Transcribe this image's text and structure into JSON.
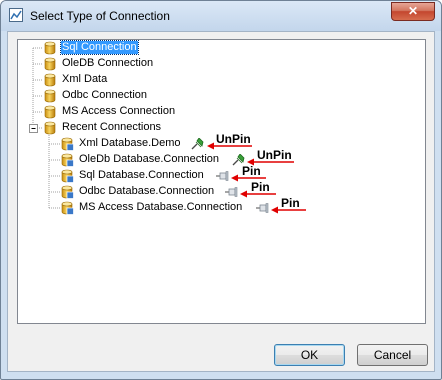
{
  "window": {
    "title": "Select Type of Connection",
    "close_glyph": "✕"
  },
  "tree": {
    "items": [
      {
        "label": "Sql Connection",
        "selected": true
      },
      {
        "label": "OleDB Connection"
      },
      {
        "label": "Xml Data"
      },
      {
        "label": "Odbc Connection"
      },
      {
        "label": "MS Access Connection"
      },
      {
        "label": "Recent Connections",
        "expanded": true,
        "expander": "−"
      }
    ],
    "recent": [
      {
        "label": "Xml Database.Demo",
        "pin_state": "pinned",
        "pin_icon": "pinned-icon",
        "annotation": "UnPin"
      },
      {
        "label": "OleDb Database.Connection",
        "pin_state": "pinned",
        "pin_icon": "pinned-icon",
        "annotation": "UnPin"
      },
      {
        "label": "Sql Database.Connection",
        "pin_state": "unpinned",
        "pin_icon": "unpinned-icon",
        "annotation": "Pin"
      },
      {
        "label": "Odbc Database.Connection",
        "pin_state": "unpinned",
        "pin_icon": "unpinned-icon",
        "annotation": "Pin"
      },
      {
        "label": "MS Access Database.Connection",
        "pin_state": "unpinned",
        "pin_icon": "unpinned-icon",
        "annotation": "Pin"
      }
    ]
  },
  "buttons": {
    "ok": "OK",
    "cancel": "Cancel"
  },
  "colors": {
    "selection": "#3399ff",
    "annotation_arrow": "#e00000",
    "pinned": "#2a8a2a",
    "unpinned": "#9aa3ad"
  }
}
